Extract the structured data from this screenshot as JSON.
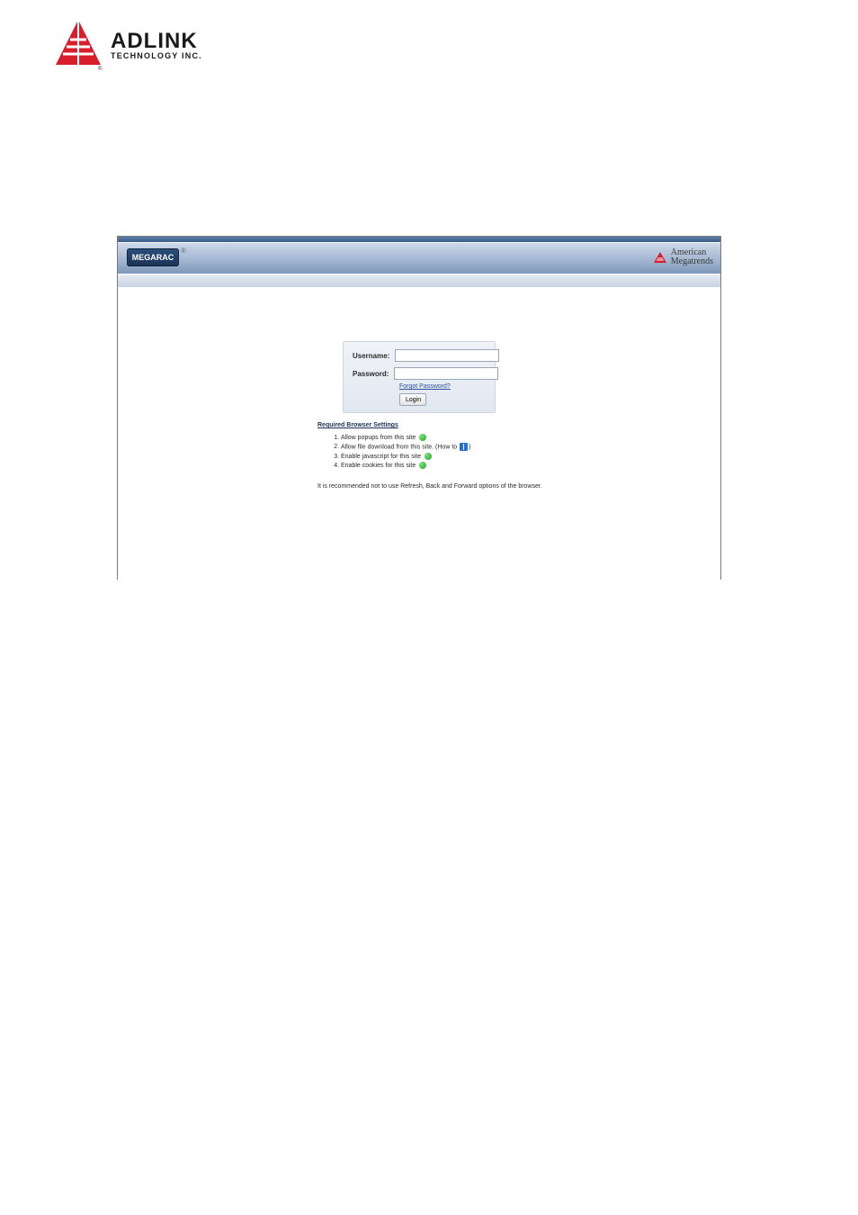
{
  "manual": {
    "vendor_brand": "ADLINK",
    "vendor_sub": "TECHNOLOGY INC."
  },
  "shot": {
    "badge": "MEGARAC",
    "badge_sup": "®",
    "ami_line1": "American",
    "ami_line2": "Megatrends",
    "login": {
      "username_label": "Username:",
      "password_label": "Password:",
      "forgot": "Forgot Password?",
      "login_btn": "Login"
    },
    "req": {
      "title": "Required Browser Settings",
      "items": [
        "Allow popups from this site",
        "Allow file download from this site. (How to",
        "Enable javascript for this site",
        "Enable cookies for this site"
      ]
    },
    "rec": "It is recommended not to use Refresh, Back and Forward options of the browser."
  }
}
